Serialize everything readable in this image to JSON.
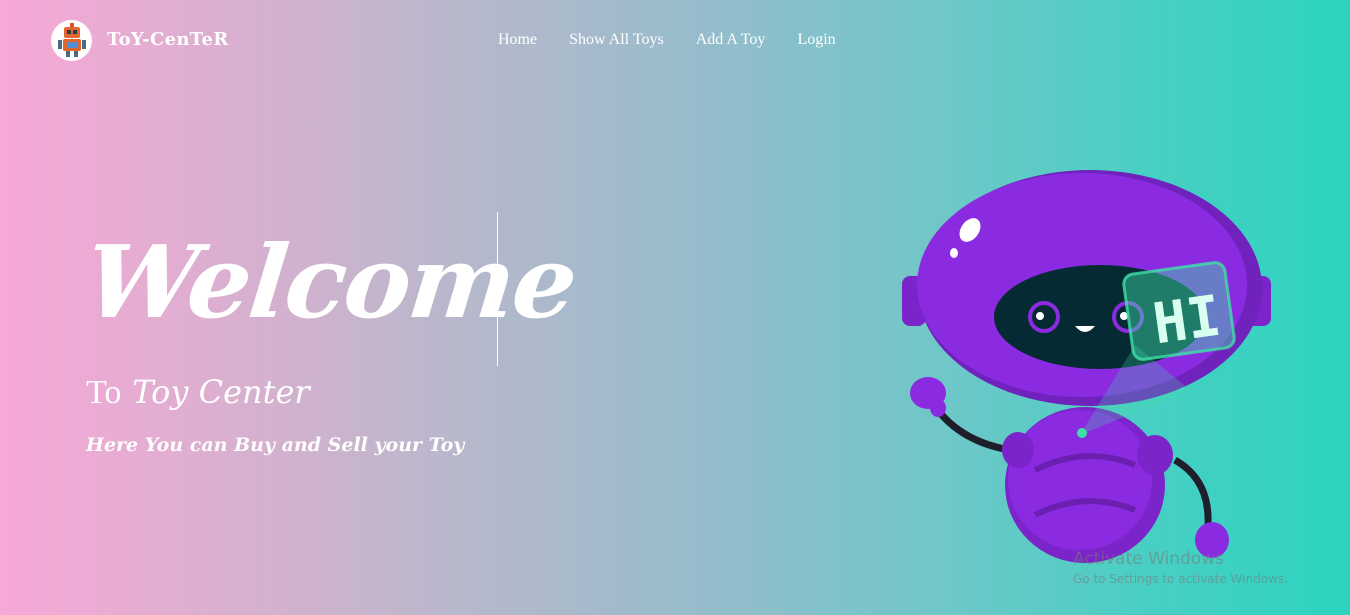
{
  "navbar": {
    "brand": "ToY-CenTeR",
    "logo_icon": "robot-logo-icon",
    "links": [
      {
        "label": "Home"
      },
      {
        "label": "Show All Toys"
      },
      {
        "label": "Add A Toy"
      },
      {
        "label": "Login"
      }
    ]
  },
  "hero": {
    "title": "Welcome",
    "subtitle_prefix": "To",
    "subtitle_highlight": "Toy Center",
    "tagline": "Here You can Buy and Sell your Toy"
  },
  "robot_illustration": {
    "screen_text": "HI",
    "icon": "robot-mascot-illustration"
  },
  "watermark": {
    "title": "Activate Windows",
    "subtitle": "Go to Settings to activate Windows."
  },
  "colors": {
    "gradient_left": "#f7a8d6",
    "gradient_right": "#2cd4c0",
    "robot_purple": "#8a2be2",
    "robot_visor": "#062a33",
    "screen_green": "#3fe0a8"
  }
}
